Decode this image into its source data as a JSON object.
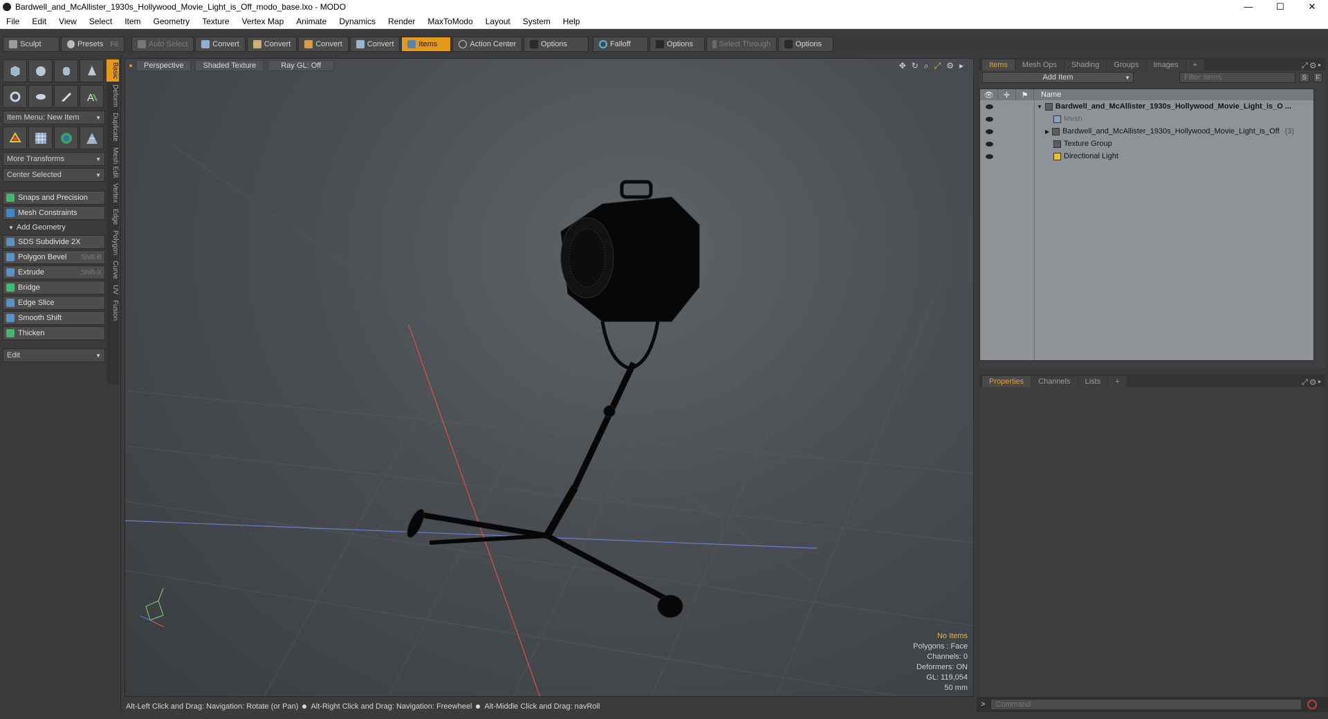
{
  "window": {
    "title": "Bardwell_and_McAllister_1930s_Hollywood_Movie_Light_is_Off_modo_base.lxo - MODO",
    "controls": [
      "—",
      "☐",
      "✕"
    ]
  },
  "menu": [
    "File",
    "Edit",
    "View",
    "Select",
    "Item",
    "Geometry",
    "Texture",
    "Vertex Map",
    "Animate",
    "Dynamics",
    "Render",
    "MaxToModo",
    "Layout",
    "System",
    "Help"
  ],
  "toolbar": {
    "sculpt": "Sculpt",
    "presets": "Presets",
    "presets_key": "F6",
    "auto_select": "Auto Select",
    "convert": "Convert",
    "items": "Items",
    "action_center": "Action Center",
    "options": "Options",
    "falloff": "Falloff",
    "select_through": "Select Through"
  },
  "left": {
    "item_menu": "Item Menu: New Item",
    "more_transforms": "More Transforms",
    "center_selected": "Center Selected",
    "snaps": "Snaps and Precision",
    "mesh_constraints": "Mesh Constraints",
    "add_geometry": "Add Geometry",
    "tools": [
      {
        "label": "SDS Subdivide 2X",
        "shortcut": ""
      },
      {
        "label": "Polygon Bevel",
        "shortcut": "Shift-B"
      },
      {
        "label": "Extrude",
        "shortcut": "Shift-X"
      },
      {
        "label": "Bridge",
        "shortcut": ""
      },
      {
        "label": "Edge Slice",
        "shortcut": ""
      },
      {
        "label": "Smooth Shift",
        "shortcut": ""
      },
      {
        "label": "Thicken",
        "shortcut": ""
      }
    ],
    "edit": "Edit",
    "vtabs": [
      "Basic",
      "Deform",
      "Duplicate",
      "Mesh Edit",
      "Vertex",
      "Edge",
      "Polygon",
      "Curve",
      "UV",
      "Fusion"
    ]
  },
  "viewport": {
    "perspective": "Perspective",
    "shaded": "Shaded Texture",
    "raygl": "Ray GL: Off",
    "info": {
      "no_items": "No Items",
      "polygons": "Polygons : Face",
      "channels": "Channels: 0",
      "deformers": "Deformers: ON",
      "gl": "GL: 119,054",
      "scale": "50 mm"
    }
  },
  "items_panel": {
    "tabs": [
      "Items",
      "Mesh Ops",
      "Shading",
      "Groups",
      "Images",
      "+"
    ],
    "add_item": "Add Item",
    "filter_placeholder": "Filter Items",
    "s_btn": "S",
    "f_btn": "F",
    "name_header": "Name",
    "rows": [
      {
        "label": "Bardwell_and_McAllister_1930s_Hollywood_Movie_Light_is_O ...",
        "count": ""
      },
      {
        "label": "Mesh",
        "count": ""
      },
      {
        "label": "Bardwell_and_McAllister_1930s_Hollywood_Movie_Light_is_Off",
        "count": "(3)"
      },
      {
        "label": "Texture Group",
        "count": ""
      },
      {
        "label": "Directional Light",
        "count": ""
      }
    ]
  },
  "props_panel": {
    "tabs": [
      "Properties",
      "Channels",
      "Lists",
      "+"
    ]
  },
  "command": {
    "prompt": ">",
    "placeholder": "Command"
  },
  "status": {
    "hint1": "Alt-Left Click and Drag: Navigation: Rotate (or Pan)",
    "hint2": "Alt-Right Click and Drag: Navigation: Freewheel",
    "hint3": "Alt-Middle Click and Drag: navRoll"
  },
  "colors": {
    "accent": "#e69a1c",
    "light_body": "#050505"
  }
}
